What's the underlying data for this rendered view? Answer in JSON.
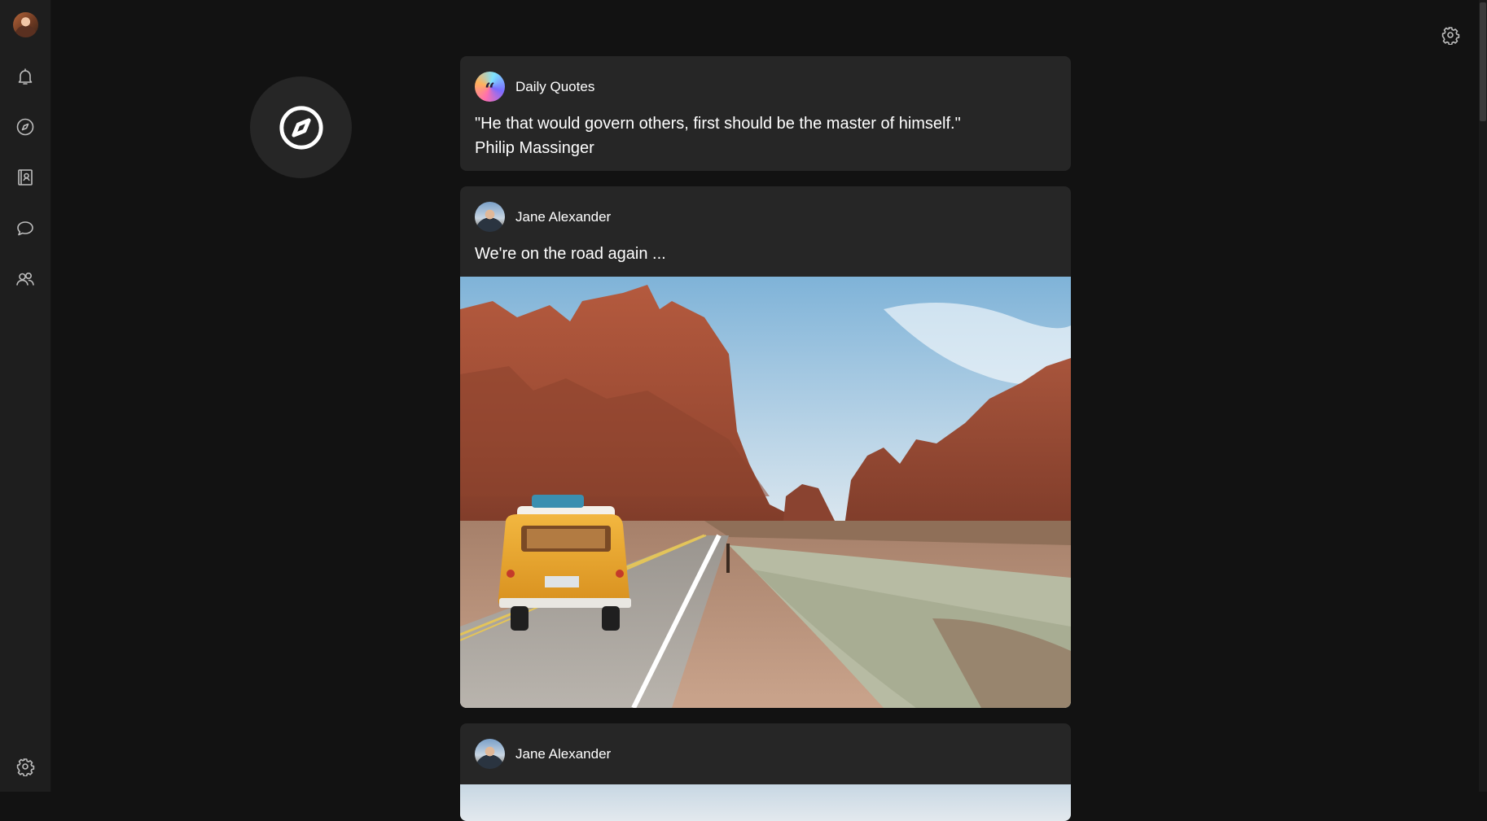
{
  "sidebar": {
    "user_avatar": "user-avatar",
    "items": [
      {
        "icon": "bell-icon",
        "label": "Notifications"
      },
      {
        "icon": "compass-icon",
        "label": "Explore"
      },
      {
        "icon": "contacts-book-icon",
        "label": "Contacts"
      },
      {
        "icon": "chat-bubble-icon",
        "label": "Messages"
      },
      {
        "icon": "people-icon",
        "label": "Groups"
      }
    ],
    "settings_icon": "gear-icon"
  },
  "header": {
    "settings_icon": "gear-icon"
  },
  "explore_badge": {
    "icon": "compass-icon"
  },
  "feed": {
    "posts": [
      {
        "author": "Daily Quotes",
        "avatar": "quote-avatar",
        "lines": [
          "\"He that would govern others, first should be the master of himself.\"",
          "Philip Massinger"
        ]
      },
      {
        "author": "Jane Alexander",
        "avatar": "jane-avatar",
        "text": "We're on the road again ...",
        "image": "desert-road-van-photo"
      },
      {
        "author": "Jane Alexander",
        "avatar": "jane-avatar",
        "image": "partial-photo"
      }
    ]
  },
  "colors": {
    "background": "#121212",
    "sidebar": "#1e1e1e",
    "card": "#262626",
    "icon": "#bdbdbd",
    "text": "#ffffff"
  }
}
